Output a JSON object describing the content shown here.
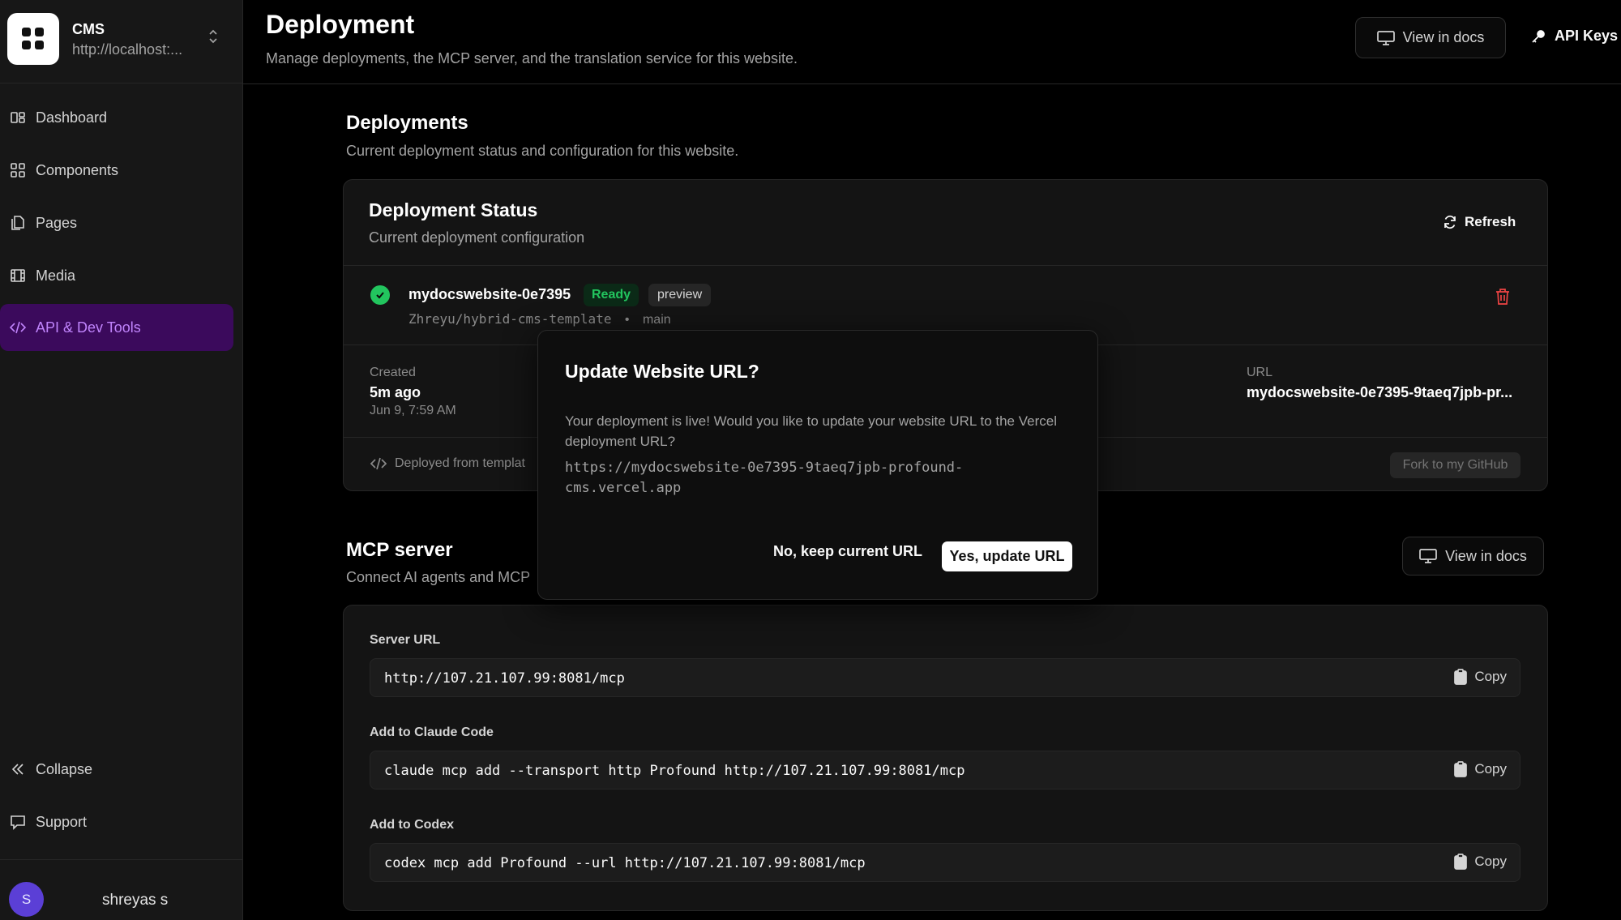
{
  "sidebar": {
    "brand": {
      "name": "CMS",
      "url": "http://localhost:..."
    },
    "items": [
      {
        "label": "Dashboard",
        "icon": "dashboard-icon"
      },
      {
        "label": "Components",
        "icon": "grid-icon"
      },
      {
        "label": "Pages",
        "icon": "pages-icon"
      },
      {
        "label": "Media",
        "icon": "film-icon"
      },
      {
        "label": "API & Dev Tools",
        "icon": "code-icon",
        "active": true
      }
    ],
    "bottom": [
      {
        "label": "Collapse",
        "icon": "chevrons-left-icon"
      },
      {
        "label": "Support",
        "icon": "message-icon"
      }
    ],
    "user": {
      "initial": "S",
      "name": "shreyas s"
    }
  },
  "header": {
    "title": "Deployment",
    "subtitle": "Manage deployments, the MCP server, and the translation service for this website.",
    "view_docs": "View in docs",
    "api_keys": "API Keys"
  },
  "deployments": {
    "title": "Deployments",
    "subtitle": "Current deployment status and configuration for this website.",
    "status_title": "Deployment Status",
    "status_subtitle": "Current deployment configuration",
    "refresh": "Refresh",
    "item": {
      "name": "mydocswebsite-0e7395",
      "status": "Ready",
      "env": "preview",
      "repo": "Zhreyu/hybrid-cms-template",
      "separator": "•",
      "branch": "main"
    },
    "created_label": "Created",
    "created_value": "5m ago",
    "created_date": "Jun 9, 7:59 AM",
    "url_label": "URL",
    "url_value": "mydocswebsite-0e7395-9taeq7jpb-pr...",
    "deployed_from": "Deployed from templat",
    "fork": "Fork to my GitHub"
  },
  "mcp": {
    "title": "MCP server",
    "subtitle": "Connect AI agents and MCP",
    "view_docs": "View in docs",
    "copy": "Copy",
    "fields": [
      {
        "label": "Server URL",
        "value": "http://107.21.107.99:8081/mcp"
      },
      {
        "label": "Add to Claude Code",
        "value": "claude mcp add --transport http Profound http://107.21.107.99:8081/mcp"
      },
      {
        "label": "Add to Codex",
        "value": "codex mcp add Profound --url http://107.21.107.99:8081/mcp"
      }
    ]
  },
  "modal": {
    "title": "Update Website URL?",
    "body": "Your deployment is live! Would you like to update your website URL to the Vercel deployment URL?",
    "url_line1": "https://mydocswebsite-0e7395-9taeq7jpb-profound-",
    "url_line2": "cms.vercel.app",
    "no": "No, keep current URL",
    "yes": "Yes, update URL"
  },
  "colors": {
    "accent": "#c084fc",
    "active_bg": "#3b0a5c",
    "ready": "#22c55e",
    "danger": "#ef4444"
  }
}
